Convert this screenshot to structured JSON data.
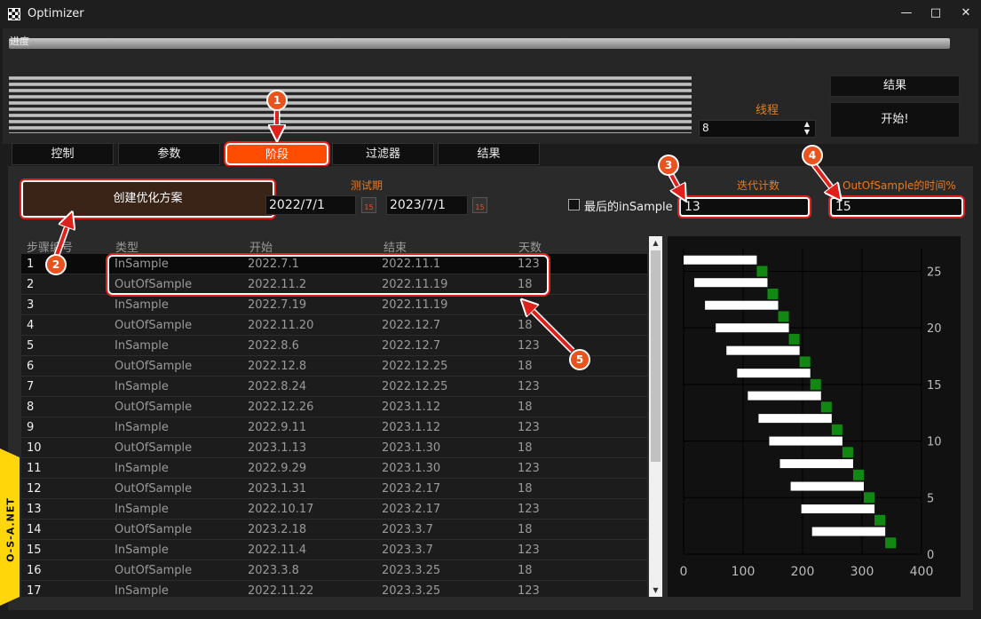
{
  "window": {
    "title": "Optimizer",
    "controls": [
      "—",
      "□",
      "✕"
    ]
  },
  "progress": {
    "label": "进度",
    "fraction": 0.99
  },
  "right_panel": {
    "results_button": "结果",
    "start_button": "开始!",
    "threads_label": "线程",
    "threads_value": "8",
    "spin_up": "▲",
    "spin_down": "▼"
  },
  "tabs": [
    "控制",
    "参数",
    "阶段",
    "过滤器",
    "结果"
  ],
  "active_tab": "阶段",
  "stage": {
    "create_button": "创建优化方案",
    "test_period_label": "测试期",
    "start_date": "2022/7/1",
    "end_date": "2023/7/1",
    "calendar_day": "15",
    "last_insample_label": "最后的inSample",
    "last_insample_checked": false,
    "iteration_label": "迭代计数",
    "iteration_value": "13",
    "oos_time_label": "OutOfSample的时间%",
    "oos_time_value": "15"
  },
  "table": {
    "headers": [
      "步骤编号",
      "类型",
      "开始",
      "结束",
      "天数"
    ],
    "rows": [
      [
        "1",
        "InSample",
        "2022.7.1",
        "2022.11.1",
        "123"
      ],
      [
        "2",
        "OutOfSample",
        "2022.11.2",
        "2022.11.19",
        "18"
      ],
      [
        "3",
        "InSample",
        "2022.7.19",
        "2022.11.19",
        ""
      ],
      [
        "4",
        "OutOfSample",
        "2022.11.20",
        "2022.12.7",
        "18"
      ],
      [
        "5",
        "InSample",
        "2022.8.6",
        "2022.12.7",
        "123"
      ],
      [
        "6",
        "OutOfSample",
        "2022.12.8",
        "2022.12.25",
        "18"
      ],
      [
        "7",
        "InSample",
        "2022.8.24",
        "2022.12.25",
        "123"
      ],
      [
        "8",
        "OutOfSample",
        "2022.12.26",
        "2023.1.12",
        "18"
      ],
      [
        "9",
        "InSample",
        "2022.9.11",
        "2023.1.12",
        "123"
      ],
      [
        "10",
        "OutOfSample",
        "2023.1.13",
        "2023.1.30",
        "18"
      ],
      [
        "11",
        "InSample",
        "2022.9.29",
        "2023.1.30",
        "123"
      ],
      [
        "12",
        "OutOfSample",
        "2023.1.31",
        "2023.2.17",
        "18"
      ],
      [
        "13",
        "InSample",
        "2022.10.17",
        "2023.2.17",
        "123"
      ],
      [
        "14",
        "OutOfSample",
        "2023.2.18",
        "2023.3.7",
        "18"
      ],
      [
        "15",
        "InSample",
        "2022.11.4",
        "2023.3.7",
        "123"
      ],
      [
        "16",
        "OutOfSample",
        "2023.3.8",
        "2023.3.25",
        "18"
      ],
      [
        "17",
        "InSample",
        "2022.11.22",
        "2023.3.25",
        "123"
      ]
    ]
  },
  "callouts": [
    "1",
    "2",
    "3",
    "4",
    "5"
  ],
  "watermark": "O-S-A.NET",
  "colors": {
    "accent": "#ff4d00",
    "callout": "#e8531e",
    "highlight": "#e0201a",
    "oos": "#118811",
    "insample": "#ffffff"
  },
  "chart_data": {
    "type": "bar",
    "orientation": "horizontal-gantt",
    "x_ticks": [
      "0",
      "100",
      "200",
      "300",
      "400"
    ],
    "y_ticks": [
      "0",
      "5",
      "10",
      "15",
      "20",
      "25"
    ],
    "xlim": [
      0,
      400
    ],
    "ylim": [
      0,
      27
    ],
    "grid": true,
    "series": [
      {
        "values": [
          {
            "y": 26,
            "start": 0,
            "end": 123
          },
          {
            "y": 24,
            "start": 18,
            "end": 141
          },
          {
            "y": 22,
            "start": 36,
            "end": 159
          },
          {
            "y": 20,
            "start": 54,
            "end": 177
          },
          {
            "y": 18,
            "start": 72,
            "end": 195
          },
          {
            "y": 16,
            "start": 90,
            "end": 213
          },
          {
            "y": 14,
            "start": 108,
            "end": 231
          },
          {
            "y": 12,
            "start": 126,
            "end": 249
          },
          {
            "y": 10,
            "start": 144,
            "end": 267
          },
          {
            "y": 8,
            "start": 162,
            "end": 285
          },
          {
            "y": 6,
            "start": 180,
            "end": 303
          },
          {
            "y": 4,
            "start": 198,
            "end": 321
          },
          {
            "y": 2,
            "start": 216,
            "end": 339
          }
        ]
      },
      {
        "values": [
          {
            "y": 25,
            "start": 123,
            "end": 141
          },
          {
            "y": 23,
            "start": 141,
            "end": 159
          },
          {
            "y": 21,
            "start": 159,
            "end": 177
          },
          {
            "y": 19,
            "start": 177,
            "end": 195
          },
          {
            "y": 17,
            "start": 195,
            "end": 213
          },
          {
            "y": 15,
            "start": 213,
            "end": 231
          },
          {
            "y": 13,
            "start": 231,
            "end": 249
          },
          {
            "y": 11,
            "start": 249,
            "end": 267
          },
          {
            "y": 9,
            "start": 267,
            "end": 285
          },
          {
            "y": 7,
            "start": 285,
            "end": 303
          },
          {
            "y": 5,
            "start": 303,
            "end": 321
          },
          {
            "y": 3,
            "start": 321,
            "end": 339
          },
          {
            "y": 1,
            "start": 339,
            "end": 357
          }
        ]
      }
    ]
  }
}
